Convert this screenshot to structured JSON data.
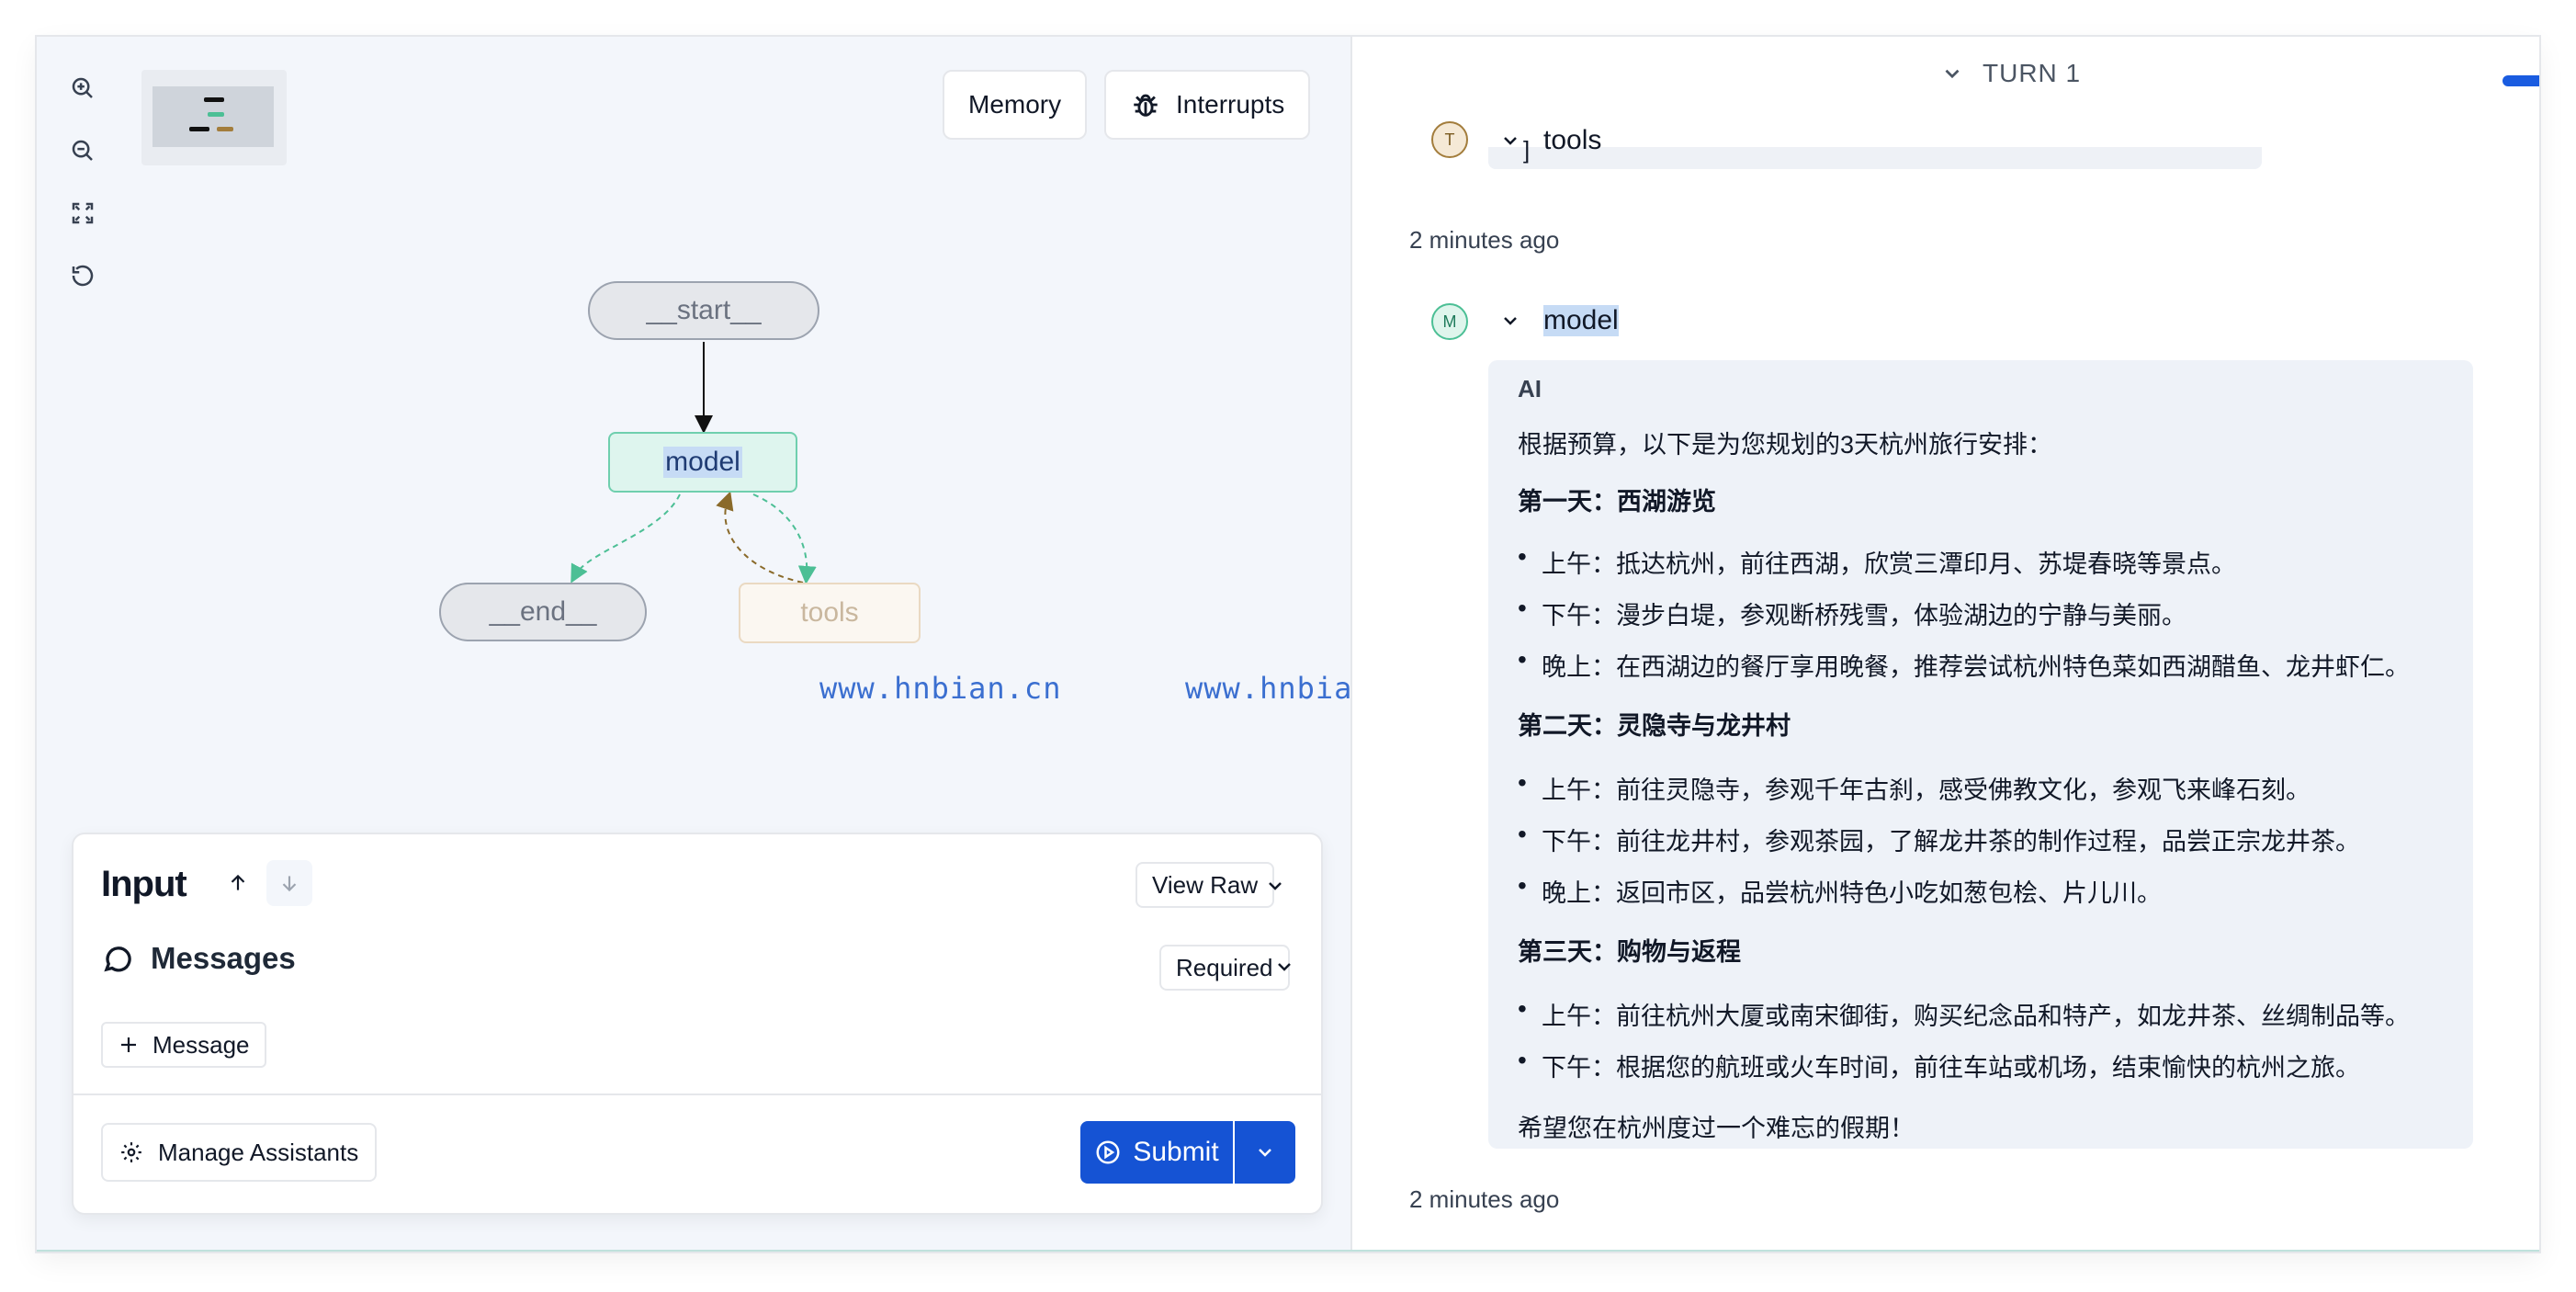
{
  "graph_panel": {
    "zoom_tools": [
      "zoom-in",
      "zoom-out",
      "fit-view",
      "reset"
    ],
    "memory_label": "Memory",
    "interrupts_label": "Interrupts",
    "nodes": {
      "start": "__start__",
      "model": "model",
      "end": "__end__",
      "tools": "tools"
    },
    "watermarks": [
      "www.hnbian.cn",
      "www.hnbian.cn"
    ]
  },
  "input_card": {
    "title": "Input",
    "view_raw_label": "View Raw",
    "messages_label": "Messages",
    "required_label": "Required",
    "add_message_label": "Message",
    "manage_assistants_label": "Manage Assistants",
    "submit_label": "Submit"
  },
  "thread": {
    "turn_label": "TURN 1",
    "tools_entry": {
      "avatar": "T",
      "name": "tools",
      "timestamp": "2 minutes ago",
      "tail": "]"
    },
    "model_entry": {
      "avatar": "M",
      "name": "model",
      "role": "AI",
      "intro": "根据预算，以下是为您规划的3天杭州旅行安排：",
      "days": [
        {
          "heading": "第一天：西湖游览",
          "items": [
            "上午：抵达杭州，前往西湖，欣赏三潭印月、苏堤春晓等景点。",
            "下午：漫步白堤，参观断桥残雪，体验湖边的宁静与美丽。",
            "晚上：在西湖边的餐厅享用晚餐，推荐尝试杭州特色菜如西湖醋鱼、龙井虾仁。"
          ]
        },
        {
          "heading": "第二天：灵隐寺与龙井村",
          "items": [
            "上午：前往灵隐寺，参观千年古刹，感受佛教文化，参观飞来峰石刻。",
            "下午：前往龙井村，参观茶园，了解龙井茶的制作过程，品尝正宗龙井茶。",
            "晚上：返回市区，品尝杭州特色小吃如葱包桧、片儿川。"
          ]
        },
        {
          "heading": "第三天：购物与返程",
          "items": [
            "上午：前往杭州大厦或南宋御街，购买纪念品和特产，如龙井茶、丝绸制品等。",
            "下午：根据您的航班或火车时间，前往车站或机场，结束愉快的杭州之旅。"
          ]
        }
      ],
      "closing": "希望您在杭州度过一个难忘的假期！",
      "timestamp": "2 minutes ago"
    }
  },
  "colors": {
    "accent": "#1553d4",
    "model_node_border": "#6fcfae",
    "tools_edge": "#8a6a2a",
    "end_edge": "#4cbf95"
  }
}
